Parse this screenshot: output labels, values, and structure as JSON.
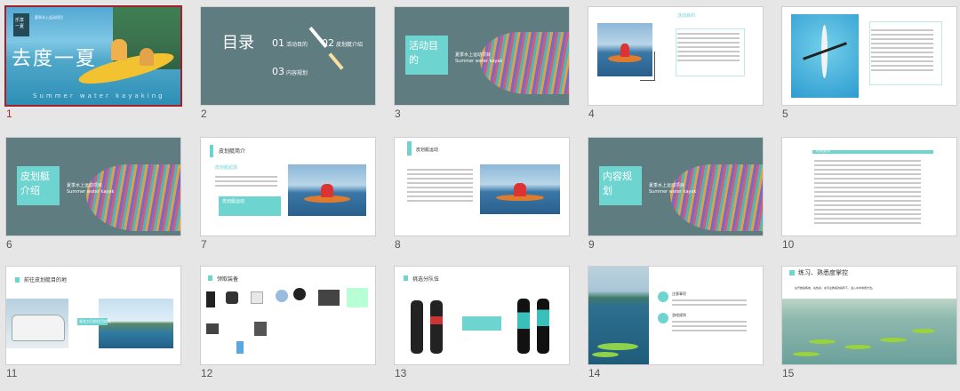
{
  "slides": [
    {
      "num": "1",
      "title": "去度一夏",
      "subtitle": "Summer water kayaking",
      "stamp": "乐享一夏",
      "caption": "夏季水上运动项目"
    },
    {
      "num": "2",
      "title": "目录",
      "items": [
        "活动目的",
        "皮划艇介绍",
        "内容规划"
      ],
      "item_nums": [
        "01",
        "02",
        "03"
      ]
    },
    {
      "num": "3",
      "title": "活动目的",
      "caption": "夏季水上运动项目",
      "sub": "Summer water kayak"
    },
    {
      "num": "4",
      "heading": "活动目的"
    },
    {
      "num": "5",
      "heading": ""
    },
    {
      "num": "6",
      "title": "皮划艇介绍",
      "caption": "夏季水上运动项目",
      "sub": "Summer water kayak"
    },
    {
      "num": "7",
      "heading": "皮划艇简介",
      "sub": "皮划艇起源",
      "note": "皮划艇运动"
    },
    {
      "num": "8",
      "heading": "皮划艇运动"
    },
    {
      "num": "9",
      "title": "内容规划",
      "caption": "夏季水上运动项目",
      "sub": "Summer water kayak"
    },
    {
      "num": "10",
      "heading": "时间安排"
    },
    {
      "num": "11",
      "heading": "前往皮划艇目的地",
      "note": "乘坐大巴前往目的地"
    },
    {
      "num": "12",
      "heading": "领取装备"
    },
    {
      "num": "13",
      "heading": "挑选分队伍"
    },
    {
      "num": "14",
      "heading": "活动流程",
      "items": [
        "注意事项",
        "游戏规则"
      ]
    },
    {
      "num": "15",
      "heading": "练习、熟悉度掌控",
      "line": "在开始操练前，先热身，在专业教练的指导下，进入水中熟悉方法。"
    }
  ]
}
